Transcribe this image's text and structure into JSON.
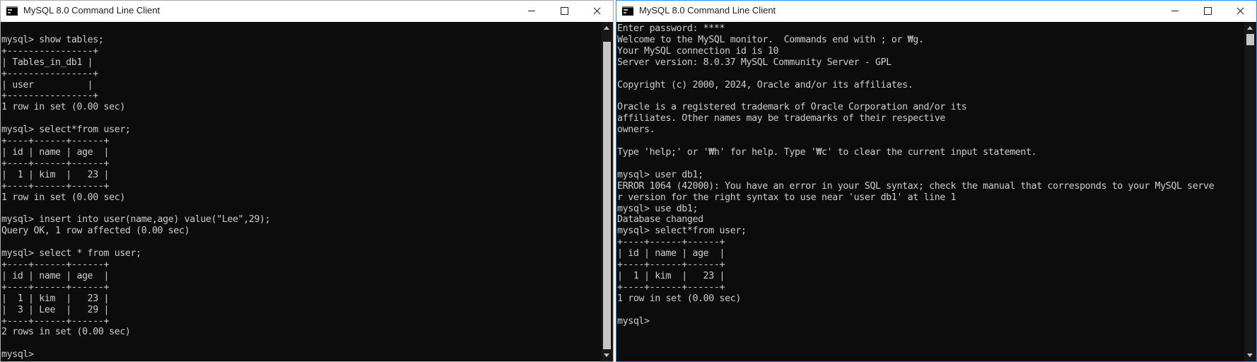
{
  "left_window": {
    "title": "MySQL 8.0 Command Line Client",
    "console_text": "\nmysql> show tables;\n+----------------+\n| Tables_in_db1 |\n+----------------+\n| user          |\n+----------------+\n1 row in set (0.00 sec)\n\nmysql> select*from user;\n+----+------+------+\n| id | name | age  |\n+----+------+------+\n|  1 | kim  |   23 |\n+----+------+------+\n1 row in set (0.00 sec)\n\nmysql> insert into user(name,age) value(\"Lee\",29);\nQuery OK, 1 row affected (0.00 sec)\n\nmysql> select * from user;\n+----+------+------+\n| id | name | age  |\n+----+------+------+\n|  1 | kim  |   23 |\n|  3 | Lee  |   29 |\n+----+------+------+\n2 rows in set (0.00 sec)\n\nmysql>"
  },
  "right_window": {
    "title": "MySQL 8.0 Command Line Client",
    "console_text": "Enter password: ****\nWelcome to the MySQL monitor.  Commands end with ; or ₩g.\nYour MySQL connection id is 10\nServer version: 8.0.37 MySQL Community Server - GPL\n\nCopyright (c) 2000, 2024, Oracle and/or its affiliates.\n\nOracle is a registered trademark of Oracle Corporation and/or its\naffiliates. Other names may be trademarks of their respective\nowners.\n\nType 'help;' or '₩h' for help. Type '₩c' to clear the current input statement.\n\nmysql> user db1;\nERROR 1064 (42000): You have an error in your SQL syntax; check the manual that corresponds to your MySQL serve\nr version for the right syntax to use near 'user db1' at line 1\nmysql> use db1;\nDatabase changed\nmysql> select*from user;\n+----+------+------+\n| id | name | age  |\n+----+------+------+\n|  1 | kim  |   23 |\n+----+------+------+\n1 row in set (0.00 sec)\n\nmysql>"
  },
  "icons": {
    "app": "console-icon",
    "minimize": "minimize-icon",
    "maximize": "maximize-icon",
    "close": "close-icon"
  },
  "colors": {
    "console_bg": "#0c0c0c",
    "console_text": "#cccccc",
    "active_border": "#1e90ff"
  }
}
